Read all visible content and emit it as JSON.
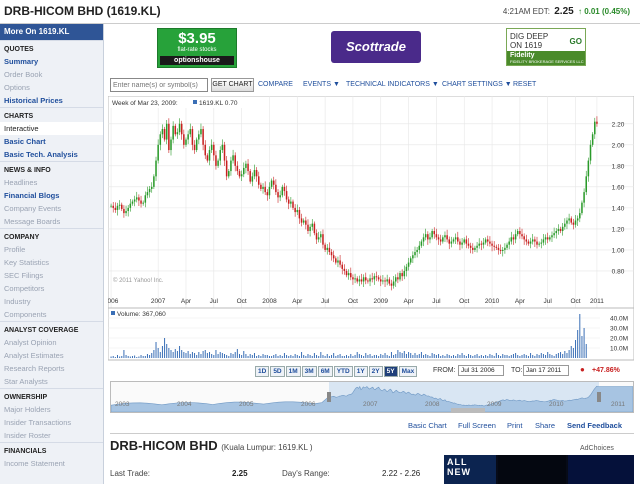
{
  "header": {
    "title": "DRB-HICOM BHD (1619.KL)",
    "time": "4:21AM EDT:",
    "price": "2.25",
    "change": "0.01 (0.45%)"
  },
  "sidebar": {
    "more": "More On 1619.KL",
    "sections": [
      {
        "title": "QUOTES",
        "items": [
          {
            "label": "Summary",
            "style": "lnk"
          },
          {
            "label": "Order Book",
            "style": "dim"
          },
          {
            "label": "Options",
            "style": "dim"
          },
          {
            "label": "Historical Prices",
            "style": "lnk"
          }
        ]
      },
      {
        "title": "CHARTS",
        "items": [
          {
            "label": "Interactive",
            "style": "act"
          },
          {
            "label": "Basic Chart",
            "style": "lnk"
          },
          {
            "label": "Basic Tech. Analysis",
            "style": "lnk"
          }
        ]
      },
      {
        "title": "NEWS & INFO",
        "items": [
          {
            "label": "Headlines",
            "style": "dim"
          },
          {
            "label": "Financial Blogs",
            "style": "lnk"
          },
          {
            "label": "Company Events",
            "style": "dim"
          },
          {
            "label": "Message Boards",
            "style": "dim"
          }
        ]
      },
      {
        "title": "COMPANY",
        "items": [
          {
            "label": "Profile",
            "style": "dim"
          },
          {
            "label": "Key Statistics",
            "style": "dim"
          },
          {
            "label": "SEC Filings",
            "style": "dim"
          },
          {
            "label": "Competitors",
            "style": "dim"
          },
          {
            "label": "Industry",
            "style": "dim"
          },
          {
            "label": "Components",
            "style": "dim"
          }
        ]
      },
      {
        "title": "ANALYST COVERAGE",
        "items": [
          {
            "label": "Analyst Opinion",
            "style": "dim"
          },
          {
            "label": "Analyst Estimates",
            "style": "dim"
          },
          {
            "label": "Research Reports",
            "style": "dim"
          },
          {
            "label": "Star Analysts",
            "style": "dim"
          }
        ]
      },
      {
        "title": "OWNERSHIP",
        "items": [
          {
            "label": "Major Holders",
            "style": "dim"
          },
          {
            "label": "Insider Transactions",
            "style": "dim"
          },
          {
            "label": "Insider Roster",
            "style": "dim"
          }
        ]
      },
      {
        "title": "FINANCIALS",
        "items": [
          {
            "label": "Income Statement",
            "style": "dim"
          }
        ]
      }
    ]
  },
  "ads": {
    "options_price": "$3.95",
    "options_sub": "flat-rate stocks",
    "options_brand": "optionshouse",
    "scottrade": "Scottrade",
    "fidelity_l1": "DIG DEEP",
    "fidelity_l2": "ON 1619",
    "fidelity_go": "GO",
    "fidelity_brand": "Fidelity",
    "fidelity_fine": "FIDELITY BROKERAGE SERVICES LLC"
  },
  "toolbar": {
    "search_placeholder": "Enter name(s) or symbol(s)",
    "get_chart": "GET CHART",
    "menu": [
      "COMPARE",
      "EVENTS ▼",
      "TECHNICAL INDICATORS ▼",
      "CHART SETTINGS ▼",
      "RESET"
    ]
  },
  "chart_data": {
    "type": "candlestick",
    "legend_week": "Week of Mar 23, 2009:",
    "legend_series": "1619.KL 0.70",
    "copyright": "© 2011 Yahoo! Inc.",
    "price_ticks": [
      "2.20",
      "2.00",
      "1.80",
      "1.60",
      "1.40",
      "1.20",
      "1.00",
      "0.80"
    ],
    "price_tick_values": [
      2.2,
      2.0,
      1.8,
      1.6,
      1.4,
      1.2,
      1.0,
      0.8
    ],
    "price_range": [
      0.6,
      2.35
    ],
    "x_labels": [
      "2006",
      "2007",
      "Apr",
      "Jul",
      "Oct",
      "2008",
      "Apr",
      "Jul",
      "Oct",
      "2009",
      "Apr",
      "Jul",
      "Oct",
      "2010",
      "Apr",
      "Jul",
      "Oct",
      "2011"
    ],
    "x_label_weeks": [
      0,
      22,
      35,
      48,
      61,
      74,
      87,
      100,
      113,
      126,
      139,
      152,
      165,
      178,
      191,
      204,
      217,
      230
    ],
    "weekly_close": [
      1.42,
      1.4,
      1.38,
      1.42,
      1.43,
      1.39,
      1.35,
      1.37,
      1.4,
      1.44,
      1.46,
      1.48,
      1.5,
      1.47,
      1.44,
      1.45,
      1.52,
      1.55,
      1.58,
      1.6,
      1.7,
      1.85,
      2.0,
      2.1,
      2.15,
      2.05,
      2.2,
      1.95,
      2.05,
      2.18,
      2.1,
      2.12,
      2.2,
      2.1,
      2.0,
      2.05,
      2.1,
      2.15,
      2.0,
      1.95,
      2.05,
      2.1,
      2.15,
      2.0,
      1.9,
      1.85,
      1.95,
      2.0,
      1.9,
      1.8,
      1.85,
      1.95,
      2.0,
      1.85,
      1.7,
      1.75,
      1.85,
      1.9,
      1.8,
      1.75,
      1.7,
      1.72,
      1.78,
      1.82,
      1.75,
      1.65,
      1.7,
      1.76,
      1.7,
      1.62,
      1.58,
      1.6,
      1.55,
      1.52,
      1.6,
      1.66,
      1.62,
      1.55,
      1.5,
      1.52,
      1.6,
      1.56,
      1.48,
      1.44,
      1.46,
      1.4,
      1.36,
      1.38,
      1.3,
      1.26,
      1.28,
      1.24,
      1.18,
      1.22,
      1.25,
      1.16,
      1.1,
      1.12,
      1.15,
      1.05,
      1.0,
      1.02,
      0.98,
      0.95,
      0.92,
      0.88,
      0.9,
      0.86,
      0.82,
      0.8,
      0.76,
      0.78,
      0.74,
      0.72,
      0.73,
      0.7,
      0.72,
      0.7,
      0.74,
      0.71,
      0.7,
      0.73,
      0.72,
      0.75,
      0.74,
      0.72,
      0.7,
      0.71,
      0.7,
      0.72,
      0.68,
      0.66,
      0.7,
      0.74,
      0.72,
      0.78,
      0.75,
      0.8,
      0.84,
      0.88,
      0.92,
      0.95,
      0.98,
      1.0,
      1.04,
      1.08,
      1.12,
      1.15,
      1.1,
      1.12,
      1.18,
      1.15,
      1.12,
      1.1,
      1.08,
      1.12,
      1.14,
      1.1,
      1.06,
      1.08,
      1.1,
      1.12,
      1.08,
      1.05,
      1.07,
      1.1,
      1.06,
      1.04,
      1.02,
      1.0,
      1.02,
      1.04,
      1.06,
      1.05,
      1.07,
      1.1,
      1.08,
      1.06,
      1.04,
      1.03,
      1.02,
      1.0,
      0.99,
      1.0,
      1.02,
      1.05,
      1.08,
      1.12,
      1.1,
      1.15,
      1.18,
      1.15,
      1.13,
      1.1,
      1.08,
      1.06,
      1.08,
      1.1,
      1.08,
      1.05,
      1.06,
      1.07,
      1.1,
      1.12,
      1.1,
      1.12,
      1.14,
      1.16,
      1.18,
      1.2,
      1.18,
      1.22,
      1.25,
      1.28,
      1.3,
      1.26,
      1.24,
      1.28,
      1.3,
      1.35,
      1.45,
      1.55,
      1.7,
      1.85,
      2.0,
      2.1,
      2.22,
      2.2
    ],
    "volume_ticks": [
      "40.0M",
      "30.0M",
      "20.0M",
      "10.0M"
    ],
    "volume_tick_values": [
      40,
      30,
      20,
      10
    ],
    "volume_range": [
      0,
      48
    ],
    "volume_label": "Volume: 367,060",
    "volume_values": [
      1.5,
      2,
      1,
      3,
      1.5,
      2,
      8,
      3,
      2,
      1.5,
      2,
      2.5,
      1,
      1.5,
      3,
      2,
      2,
      4,
      3,
      5,
      8,
      16,
      10,
      6,
      12,
      20,
      14,
      10,
      8,
      6,
      9,
      7,
      12,
      8,
      6,
      5,
      7,
      4,
      6,
      5,
      3,
      6,
      4,
      7,
      8,
      5,
      6,
      4,
      3,
      8,
      4,
      6,
      5,
      4,
      3,
      2,
      5,
      4,
      6,
      9,
      4,
      3,
      7,
      4,
      2,
      4,
      3,
      5,
      2,
      3,
      2,
      4,
      3,
      3,
      2,
      2,
      3,
      4,
      2,
      3,
      2,
      5,
      3,
      2,
      3,
      2,
      4,
      3,
      2,
      6,
      3,
      2,
      4,
      3,
      2,
      5,
      3,
      2,
      6,
      3,
      2,
      4,
      2,
      3,
      5,
      2,
      3,
      4,
      2,
      2,
      3,
      2,
      4,
      2,
      3,
      6,
      4,
      3,
      2,
      5,
      3,
      4,
      2,
      3,
      3,
      2,
      4,
      3,
      5,
      3,
      2,
      6,
      3,
      4,
      8,
      6,
      5,
      7,
      4,
      6,
      5,
      3,
      5,
      3,
      4,
      6,
      3,
      4,
      3,
      2,
      5,
      4,
      3,
      4,
      2,
      3,
      2,
      4,
      3,
      2,
      3,
      2,
      4,
      3,
      5,
      3,
      2,
      4,
      3,
      2,
      3,
      4,
      2,
      3,
      2,
      3,
      2,
      4,
      3,
      2,
      5,
      3,
      2,
      4,
      3,
      3,
      2,
      3,
      4,
      5,
      3,
      2,
      3,
      4,
      3,
      2,
      5,
      3,
      2,
      4,
      3,
      5,
      4,
      3,
      6,
      4,
      3,
      2,
      4,
      5,
      6,
      4,
      7,
      5,
      8,
      12,
      10,
      18,
      28,
      44,
      22,
      30,
      14
    ],
    "ranges": [
      "1D",
      "5D",
      "1M",
      "3M",
      "6M",
      "YTD",
      "1Y",
      "2Y",
      "5Y",
      "Max"
    ],
    "active_range": "5Y",
    "from_label": "FROM:",
    "from_date": "Jul 31 2006",
    "to_label": "TO:",
    "to_date": "Jan 17 2011",
    "pct_change": "+47.86%",
    "nav_years": [
      "2003",
      "2004",
      "2005",
      "2006",
      "2007",
      "2008",
      "2009",
      "2010",
      "2011"
    ]
  },
  "chart_links": [
    "Basic Chart",
    "Full Screen",
    "Print",
    "Share",
    "Send Feedback"
  ],
  "bottom": {
    "name": "DRB-HICOM BHD",
    "exchange": "(Kuala Lumpur: 1619.KL )",
    "last_trade_label": "Last Trade:",
    "last_trade": "2.25",
    "days_range_label": "Day's Range:",
    "days_range": "2.22 - 2.26",
    "adchoices": "AdChoices",
    "ad_text": "ALL NEW"
  },
  "colors": {
    "up": "#2a9a2a",
    "down": "#c82020",
    "volume": "#3a6fb6",
    "nav_fill": "#a7c4e2",
    "link": "#1f4e9c",
    "sidebar_bg": "#eef1f6",
    "more_bg": "#2f5596"
  }
}
